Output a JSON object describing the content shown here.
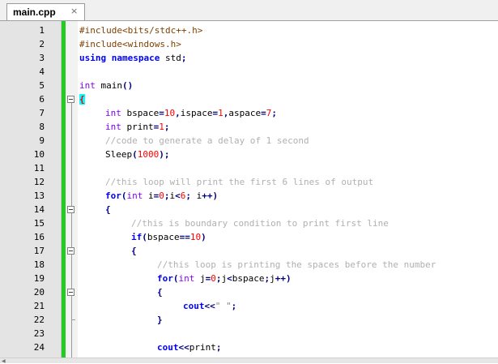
{
  "tab": {
    "label": "main.cpp",
    "close_icon": "×"
  },
  "lines": [
    {
      "n": "1",
      "indent": 0,
      "tokens": [
        [
          "#include<bits/stdc++.h>",
          "pre"
        ]
      ]
    },
    {
      "n": "2",
      "indent": 0,
      "tokens": [
        [
          "#include<windows.h>",
          "pre"
        ]
      ]
    },
    {
      "n": "3",
      "indent": 0,
      "tokens": [
        [
          "using namespace",
          "kw"
        ],
        [
          " std",
          "plain"
        ],
        [
          ";",
          "op"
        ]
      ]
    },
    {
      "n": "4",
      "indent": 0,
      "tokens": []
    },
    {
      "n": "5",
      "indent": 0,
      "tokens": [
        [
          "int",
          "type"
        ],
        [
          " main",
          "plain"
        ],
        [
          "()",
          "op"
        ]
      ]
    },
    {
      "n": "6",
      "indent": 0,
      "tokens": [
        [
          "{",
          "brace-hl"
        ]
      ]
    },
    {
      "n": "7",
      "indent": 1,
      "tokens": [
        [
          "int",
          "type"
        ],
        [
          " bspace",
          "plain"
        ],
        [
          "=",
          "op"
        ],
        [
          "10",
          "num"
        ],
        [
          ",",
          "op"
        ],
        [
          "ispace",
          "plain"
        ],
        [
          "=",
          "op"
        ],
        [
          "1",
          "num"
        ],
        [
          ",",
          "op"
        ],
        [
          "aspace",
          "plain"
        ],
        [
          "=",
          "op"
        ],
        [
          "7",
          "num"
        ],
        [
          ";",
          "op"
        ]
      ]
    },
    {
      "n": "8",
      "indent": 1,
      "tokens": [
        [
          "int",
          "type"
        ],
        [
          " print",
          "plain"
        ],
        [
          "=",
          "op"
        ],
        [
          "1",
          "num"
        ],
        [
          ";",
          "op"
        ]
      ]
    },
    {
      "n": "9",
      "indent": 1,
      "tokens": [
        [
          "//code to generate a delay of 1 second",
          "cmt"
        ]
      ]
    },
    {
      "n": "10",
      "indent": 1,
      "tokens": [
        [
          "Sleep",
          "plain"
        ],
        [
          "(",
          "op"
        ],
        [
          "1000",
          "num"
        ],
        [
          ");",
          "op"
        ]
      ]
    },
    {
      "n": "11",
      "indent": 0,
      "tokens": []
    },
    {
      "n": "12",
      "indent": 1,
      "tokens": [
        [
          "//this loop will print the first 6 lines of output",
          "cmt"
        ]
      ]
    },
    {
      "n": "13",
      "indent": 1,
      "tokens": [
        [
          "for",
          "kw"
        ],
        [
          "(",
          "op"
        ],
        [
          "int",
          "type"
        ],
        [
          " i",
          "plain"
        ],
        [
          "=",
          "op"
        ],
        [
          "0",
          "num"
        ],
        [
          ";",
          "op"
        ],
        [
          "i",
          "plain"
        ],
        [
          "<",
          "op"
        ],
        [
          "6",
          "num"
        ],
        [
          ";",
          "op"
        ],
        [
          " i",
          "plain"
        ],
        [
          "++)",
          "op"
        ]
      ]
    },
    {
      "n": "14",
      "indent": 1,
      "tokens": [
        [
          "{",
          "op"
        ]
      ]
    },
    {
      "n": "15",
      "indent": 2,
      "tokens": [
        [
          "//this is boundary condition to print first line",
          "cmt"
        ]
      ]
    },
    {
      "n": "16",
      "indent": 2,
      "tokens": [
        [
          "if",
          "kw"
        ],
        [
          "(",
          "op"
        ],
        [
          "bspace",
          "plain"
        ],
        [
          "==",
          "op"
        ],
        [
          "10",
          "num"
        ],
        [
          ")",
          "op"
        ]
      ]
    },
    {
      "n": "17",
      "indent": 2,
      "tokens": [
        [
          "{",
          "op"
        ]
      ]
    },
    {
      "n": "18",
      "indent": 3,
      "tokens": [
        [
          "//this loop is printing the spaces before the number",
          "cmt"
        ]
      ]
    },
    {
      "n": "19",
      "indent": 3,
      "tokens": [
        [
          "for",
          "kw"
        ],
        [
          "(",
          "op"
        ],
        [
          "int",
          "type"
        ],
        [
          " j",
          "plain"
        ],
        [
          "=",
          "op"
        ],
        [
          "0",
          "num"
        ],
        [
          ";",
          "op"
        ],
        [
          "j",
          "plain"
        ],
        [
          "<",
          "op"
        ],
        [
          "bspace",
          "plain"
        ],
        [
          ";",
          "op"
        ],
        [
          "j",
          "plain"
        ],
        [
          "++)",
          "op"
        ]
      ]
    },
    {
      "n": "20",
      "indent": 3,
      "tokens": [
        [
          "{",
          "op"
        ]
      ]
    },
    {
      "n": "21",
      "indent": 4,
      "tokens": [
        [
          "cout",
          "kw"
        ],
        [
          "<<",
          "op"
        ],
        [
          "\" \"",
          "str"
        ],
        [
          ";",
          "op"
        ]
      ]
    },
    {
      "n": "22",
      "indent": 3,
      "tokens": [
        [
          "}",
          "op"
        ]
      ]
    },
    {
      "n": "23",
      "indent": 0,
      "tokens": []
    },
    {
      "n": "24",
      "indent": 3,
      "tokens": [
        [
          "cout",
          "kw"
        ],
        [
          "<<",
          "op"
        ],
        [
          "print",
          "plain"
        ],
        [
          ";",
          "op"
        ]
      ]
    }
  ],
  "folds": {
    "boxes": [
      "6",
      "14",
      "17",
      "20"
    ],
    "ends": [
      "22"
    ]
  },
  "colors": {
    "change_bar": "#22cc22",
    "brace_highlight": "#00ffff",
    "keyword": "#0000ff",
    "type": "#8000ff",
    "number": "#ff0000",
    "comment": "#b0b0b0",
    "preprocessor": "#804000"
  },
  "scrollbar": {
    "left_arrow_icon": "◀"
  }
}
